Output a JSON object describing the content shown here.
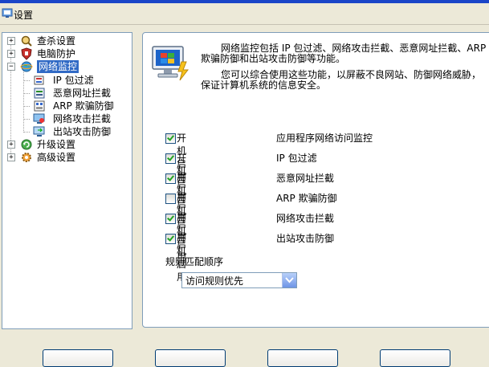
{
  "window": {
    "title": "设置"
  },
  "tree": {
    "items": [
      {
        "label": "查杀设置",
        "icon": "magnifier-icon",
        "expander": "+"
      },
      {
        "label": "电脑防护",
        "icon": "shield-icon",
        "expander": "+"
      },
      {
        "label": "网络监控",
        "icon": "network-globe-icon",
        "expander": "−",
        "selected": true
      },
      {
        "label": "IP 包过滤",
        "icon": "ip-filter-icon"
      },
      {
        "label": "恶意网址拦截",
        "icon": "url-block-icon"
      },
      {
        "label": "ARP 欺骗防御",
        "icon": "arp-defense-icon"
      },
      {
        "label": "网络攻击拦截",
        "icon": "attack-block-icon"
      },
      {
        "label": "出站攻击防御",
        "icon": "outbound-defense-icon"
      },
      {
        "label": "升级设置",
        "icon": "update-icon",
        "expander": "+"
      },
      {
        "label": "高级设置",
        "icon": "advanced-gear-icon",
        "expander": "+"
      }
    ]
  },
  "main": {
    "desc_line1": "网络监控包括 IP 包过滤、网络攻击拦截、恶意网址拦截、ARP",
    "desc_line2": "欺骗防御和出站攻击防御等功能。",
    "desc_line3": "您可以综合使用这些功能，以屏蔽不良网站、防御网络威胁，",
    "desc_line4": "保证计算机系统的信息安全。",
    "toggle_label": "开机启用",
    "features": [
      {
        "name": "应用程序网络访问监控",
        "checked": true
      },
      {
        "name": "IP 包过滤",
        "checked": true
      },
      {
        "name": "恶意网址拦截",
        "checked": true
      },
      {
        "name": "ARP 欺骗防御",
        "checked": false
      },
      {
        "name": "网络攻击拦截",
        "checked": true
      },
      {
        "name": "出站攻击防御",
        "checked": true
      }
    ],
    "order_label": "规则匹配顺序",
    "order_value": "访问规则优先"
  },
  "colors": {
    "titlebar": "#1A45C8",
    "selection": "#316AC5",
    "border": "#7F9DB9"
  }
}
